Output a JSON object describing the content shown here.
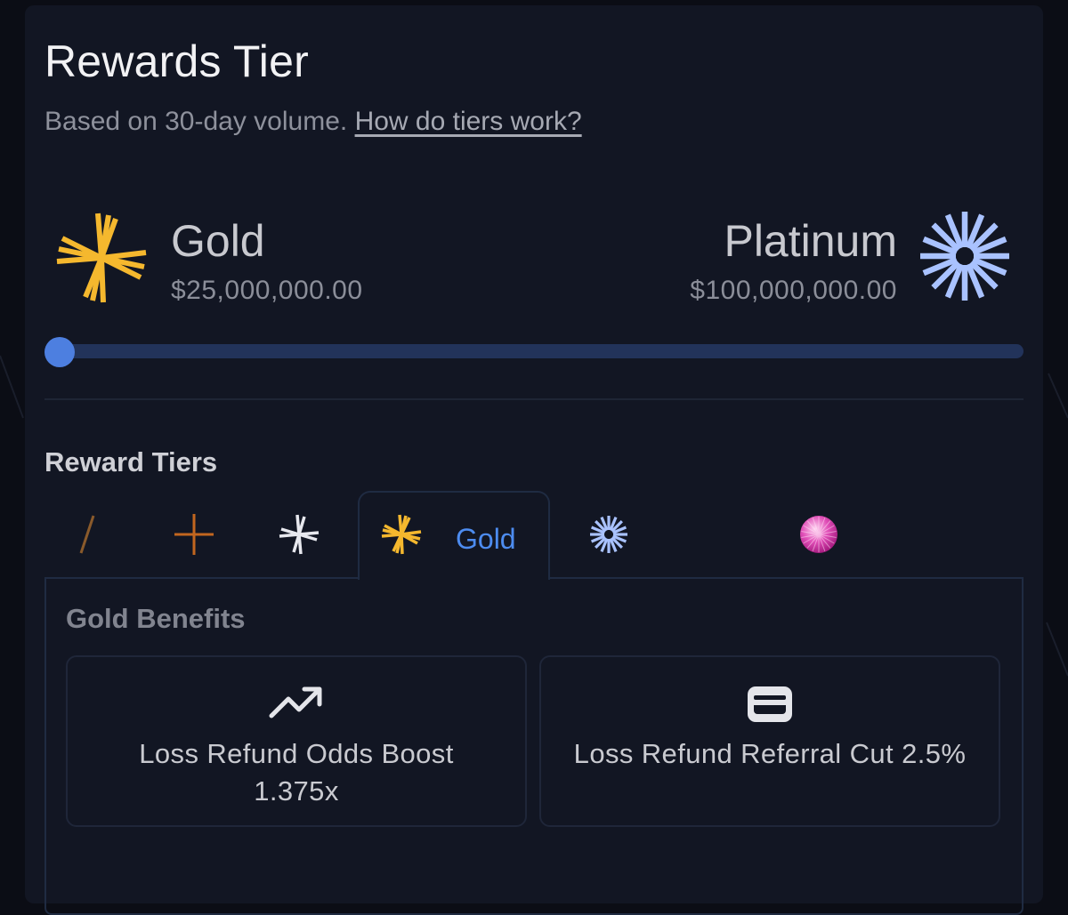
{
  "header": {
    "title": "Rewards Tier",
    "subtitle": "Based on 30-day volume.",
    "help_link": "How do tiers work?"
  },
  "current_tier": {
    "name": "Gold",
    "amount": "$25,000,000.00",
    "icon": "gold-star-icon",
    "color": "#f5b82e"
  },
  "next_tier": {
    "name": "Platinum",
    "amount": "$100,000,000.00",
    "icon": "platinum-starburst-icon",
    "color": "#a9c2ff"
  },
  "progress": {
    "fraction": 0.0,
    "track_color": "#22335a",
    "knob_color": "#4d7fe0"
  },
  "reward_tiers": {
    "title": "Reward Tiers",
    "tabs": [
      {
        "icon": "slash-icon",
        "label": ""
      },
      {
        "icon": "plus-icon",
        "label": ""
      },
      {
        "icon": "silver-star-icon",
        "label": ""
      },
      {
        "icon": "gold-star-icon",
        "label": "Gold",
        "active": true
      },
      {
        "icon": "platinum-starburst-icon",
        "label": ""
      },
      {
        "icon": "diamond-starburst-icon",
        "label": ""
      },
      {
        "icon": "pink-sunburst-icon",
        "label": ""
      }
    ],
    "active_color": "#4d8cf0"
  },
  "benefits": {
    "title": "Gold Benefits",
    "items": [
      {
        "icon": "trending-up-icon",
        "label": "Loss Refund Odds Boost 1.375x"
      },
      {
        "icon": "wallet-icon",
        "label": "Loss Refund Referral Cut 2.5%"
      }
    ]
  }
}
